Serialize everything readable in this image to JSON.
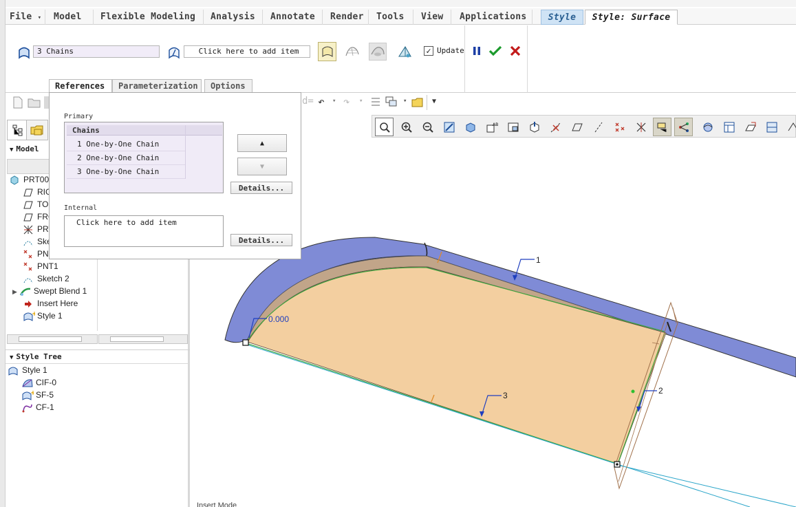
{
  "menu": {
    "file": "File",
    "model": "Model",
    "flexible_modeling": "Flexible Modeling",
    "analysis": "Analysis",
    "annotate": "Annotate",
    "render": "Render",
    "tools": "Tools",
    "view": "View",
    "applications": "Applications",
    "style": "Style",
    "style_surface": "Style: Surface"
  },
  "dashboard": {
    "primary_collector_value": "3 Chains",
    "internal_collector_placeholder": "Click here to add item",
    "update_label": "Update",
    "update_checked": true
  },
  "tabs": {
    "references": "References",
    "parameterization": "Parameterization",
    "options": "Options"
  },
  "references_panel": {
    "primary_label": "Primary",
    "chains_header": "Chains",
    "chains": [
      "1 One-by-One Chain",
      "2 One-by-One Chain",
      "3 One-by-One Chain"
    ],
    "details_button": "Details...",
    "internal_label": "Internal",
    "internal_placeholder": "Click here to add item",
    "internal_details_button": "Details..."
  },
  "navigator": {
    "model_section": "Model",
    "model_tree": [
      {
        "label": "PRT00",
        "icon": "part-icon"
      },
      {
        "label": "RIG",
        "icon": "datum-plane-icon"
      },
      {
        "label": "TOI",
        "icon": "datum-plane-icon"
      },
      {
        "label": "FRO",
        "icon": "datum-plane-icon"
      },
      {
        "label": "PRT",
        "icon": "csys-icon"
      },
      {
        "label": "Ske",
        "icon": "sketch-icon"
      },
      {
        "label": "PNT",
        "icon": "datum-point-icon"
      },
      {
        "label": "PNT1",
        "icon": "datum-point-icon"
      },
      {
        "label": "Sketch 2",
        "icon": "sketch-icon"
      },
      {
        "label": "Swept Blend 1",
        "icon": "swept-blend-icon"
      },
      {
        "label": "Insert Here",
        "icon": "insert-arrow-icon"
      },
      {
        "label": "Style 1",
        "icon": "style-icon"
      }
    ],
    "style_tree_section": "Style Tree",
    "style_tree": [
      {
        "label": "Style 1",
        "icon": "style-icon"
      },
      {
        "label": "CIF-0",
        "icon": "cif-icon"
      },
      {
        "label": "SF-5",
        "icon": "surface-icon"
      },
      {
        "label": "CF-1",
        "icon": "curve-icon"
      }
    ]
  },
  "graphics": {
    "chain_labels": [
      "1",
      "2",
      "3"
    ],
    "dimension_value": "0.000",
    "mode_text": "Insert Mode"
  },
  "colors": {
    "surface_fill": "#f3cfa0",
    "sweep_blue": "#7f8bd6",
    "chain_green": "#3fa63f",
    "curve_cyan": "#2aa5c9",
    "accent_blue": "#1f3fbf"
  }
}
